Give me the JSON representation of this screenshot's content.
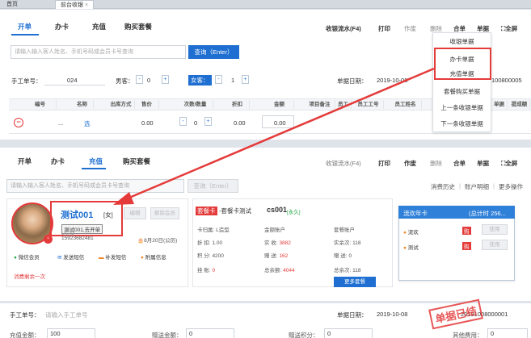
{
  "tabs": [
    {
      "label": "首页"
    },
    {
      "label": "前台收银"
    }
  ],
  "top": {
    "nav": [
      {
        "label": "开单"
      },
      {
        "label": "办卡"
      },
      {
        "label": "充值"
      },
      {
        "label": "购买套餐"
      }
    ],
    "toolbar": {
      "flow": "收银流水(F4)",
      "print": "打印",
      "void": "作废",
      "delete": "删除",
      "merge": "合单",
      "bill": "单据",
      "fullscreen": "全屏"
    },
    "search_placeholder": "请输入输入客人姓名、手机号码或会员卡号查询",
    "search_button": "查询（Enter）",
    "manual_no_label": "手工单号：",
    "manual_no_value": "024",
    "male_label": "男客：",
    "male_value": "0",
    "female_label": "女客：",
    "female_value": "1",
    "date_label": "单据日期：",
    "date_value": "2019-10-08",
    "bill_no": "100800005",
    "table": {
      "headers": [
        "编号",
        "名称",
        "出库方式",
        "售价",
        "次数/数量",
        "折扣",
        "金额",
        "项目备注",
        "员工",
        "员工工号",
        "员工姓名",
        "单据",
        "提成额"
      ],
      "row": {
        "no": "...",
        "name": "选",
        "price": "0.00",
        "qty": "0",
        "discount": "0.00",
        "amount": "0.00"
      }
    },
    "dropdown": [
      "收银单据",
      "办卡单据",
      "充值单据",
      "套餐购买单据",
      "上一条收银单据",
      "下一条收银单据"
    ]
  },
  "bottom": {
    "nav": [
      {
        "label": "开单"
      },
      {
        "label": "办卡"
      },
      {
        "label": "充值"
      },
      {
        "label": "购买套餐"
      }
    ],
    "toolbar": {
      "flow": "收银流水(F4)",
      "print": "打印",
      "void": "作废",
      "delete": "删除",
      "merge": "合单",
      "bill": "单据",
      "fullscreen": "全屏"
    },
    "search_placeholder": "请输入输入客人姓名、手机号码或会员卡号查询",
    "search_button": "查询（Enter）",
    "links": {
      "history": "消费历史",
      "account": "账户明细",
      "more": "更多操作"
    },
    "member": {
      "name": "测试001",
      "gender": "[女]",
      "edit_btn": "编辑",
      "clear_btn": "解除会员",
      "tooltip": "测试001,去开单",
      "phone": "15923682481",
      "level": "L造型",
      "date": "8月20日(公历)",
      "actions": [
        "微信会员",
        "发送短信",
        "补发短信",
        "附属信息"
      ],
      "remaining": "消费剩余一次"
    },
    "card": {
      "tag": "套餐卡",
      "title": "-套餐卡测试",
      "code": "cs001",
      "status": "[永久]",
      "store_label": "卡归属:",
      "store": "L造型",
      "discount_label": "折 扣:",
      "discount": "1.00",
      "points_label": "积 分:",
      "points": "4200",
      "debt_label": "挂 账:",
      "debt": "0",
      "money_account": "金额账户",
      "real_label": "实 收:",
      "real": "3882",
      "gift_label": "赠 送:",
      "gift": "162",
      "total_label": "总余额:",
      "total": "4044",
      "package_account": "套餐账户",
      "pk_real_label": "实余次:",
      "pk_real": "118",
      "pk_gift_label": "赠 送:",
      "pk_gift": "0",
      "pk_total_label": "总余次:",
      "pk_total": "118",
      "more_btn": "更多套餐"
    },
    "annual": {
      "title": "流欢年卡",
      "count": "(总计时 256...",
      "items": [
        {
          "name": "流欢",
          "badge": "购",
          "use": "使用"
        },
        {
          "name": "测试",
          "badge": "购",
          "use": "使用"
        }
      ]
    },
    "manual_no_label": "手工单号：",
    "manual_no_placeholder": "请输入手工单号",
    "date_label": "单据日期：",
    "date_value": "2019-10-08",
    "bill_no": "20191008000001",
    "stamp": "单据已结",
    "sum_labels": {
      "recharge": "充值金额：",
      "recharge_val": "100",
      "gift": "赠送金额：",
      "gift_val": "0",
      "gift_points": "赠送积分：",
      "gift_points_val": "0",
      "other": "其他费用：",
      "other_val": "0"
    }
  },
  "colors": {
    "accent": "#1e6fd1",
    "red": "#e43a3a",
    "green": "#2ba84a",
    "orange": "#f08a24"
  }
}
